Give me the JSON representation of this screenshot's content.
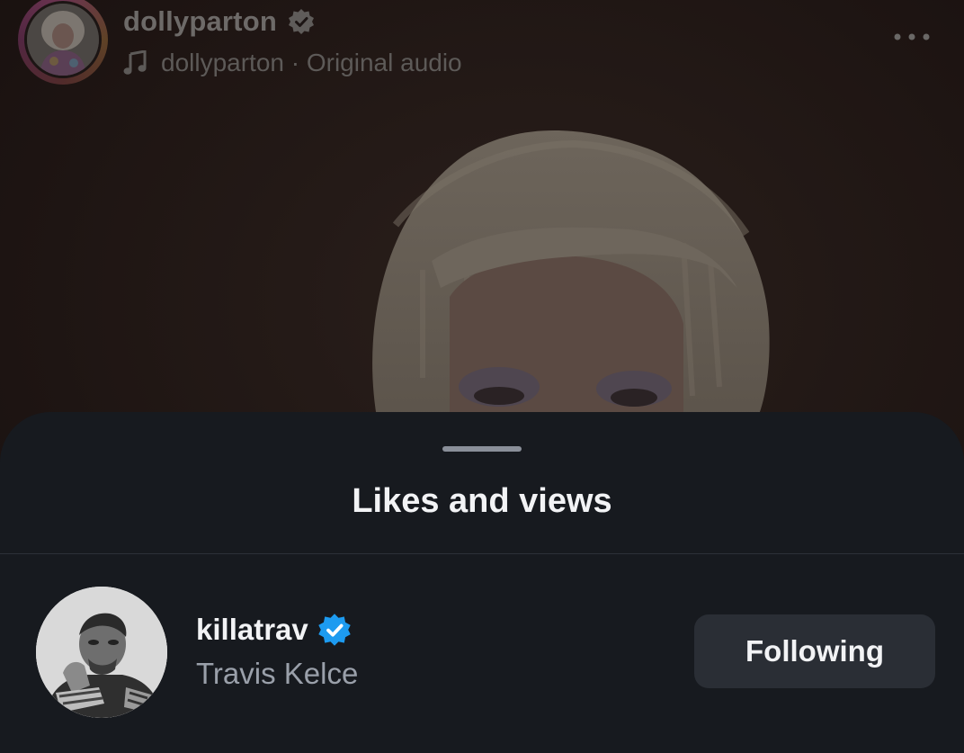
{
  "post": {
    "username": "dollyparton",
    "audio_label": "dollyparton · Original audio"
  },
  "sheet": {
    "title": "Likes and views",
    "users": [
      {
        "handle": "killatrav",
        "full_name": "Travis Kelce",
        "follow_button": "Following"
      }
    ]
  },
  "colors": {
    "verified_blue": "#1d9bf0",
    "sheet_bg": "#171a1f",
    "button_bg": "#2a2e35"
  },
  "icons": {
    "verified": "verified-badge-icon",
    "audio": "music-note-icon",
    "more": "more-options-icon"
  }
}
